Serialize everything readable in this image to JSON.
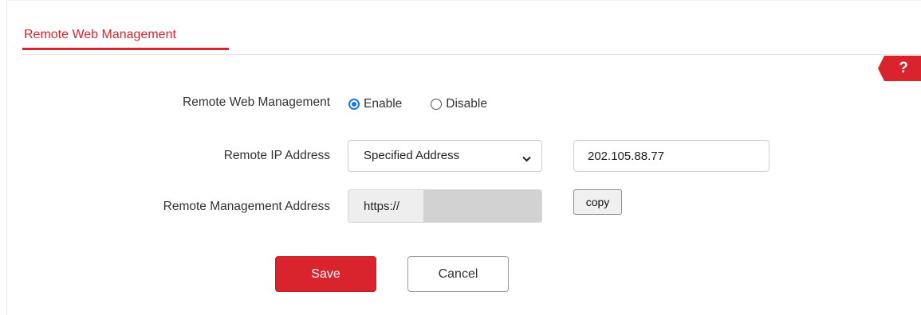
{
  "header": {
    "tab_title": "Remote Web Management",
    "help_label": "?"
  },
  "form": {
    "remote_web_management": {
      "label": "Remote Web Management",
      "options": [
        {
          "label": "Enable",
          "selected": true
        },
        {
          "label": "Disable",
          "selected": false
        }
      ]
    },
    "remote_ip_address": {
      "label": "Remote IP Address",
      "select_value": "Specified Address",
      "ip_value": "202.105.88.77"
    },
    "remote_management_address": {
      "label": "Remote Management Address",
      "value": "https://",
      "copy_label": "copy"
    }
  },
  "actions": {
    "save_label": "Save",
    "cancel_label": "Cancel"
  },
  "colors": {
    "accent": "#d9232d",
    "radio_selected": "#1a73e8",
    "readonly_bg": "#eeeeee",
    "redaction": "#d2d2d2"
  },
  "icons": {
    "select": "chevron-down-icon",
    "help": "help-question-icon"
  }
}
